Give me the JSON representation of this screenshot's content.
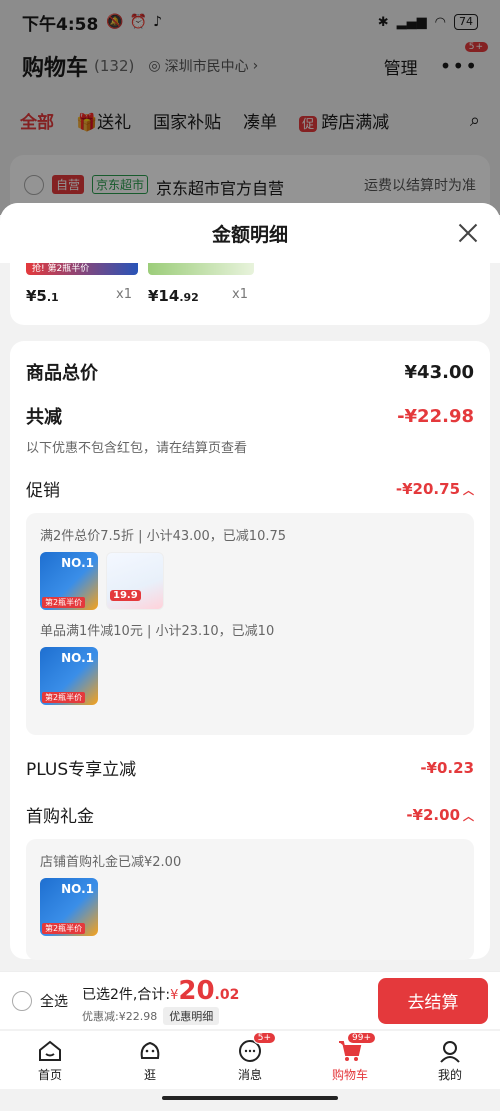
{
  "status": {
    "time": "下午4:58",
    "battery": "74"
  },
  "cart": {
    "title": "购物车",
    "count": "(132)",
    "location": "深圳市民中心",
    "manage": "管理",
    "more_badge": "5+"
  },
  "tabs": [
    "全部",
    "送礼",
    "国家补贴",
    "凑单",
    "跨店满减"
  ],
  "promo_tab_tag": "促",
  "store": {
    "self_tag": "自营",
    "jd_tag": "京东超市",
    "name": "京东超市官方自营",
    "shipping": "运费以结算时为准"
  },
  "sheet": {
    "title": "金额明细"
  },
  "items": [
    {
      "thumb_label": "抢! 第2瓶半价",
      "price_int": "¥5",
      "price_dec": ".1",
      "qty": "x1"
    },
    {
      "price_int": "¥14",
      "price_dec": ".92",
      "qty": "x1"
    }
  ],
  "detail": {
    "total_label": "商品总价",
    "total_value": "¥43.00",
    "reduce_label": "共减",
    "reduce_value": "-¥22.98",
    "hint": "以下优惠不包含红包，请在结算页查看",
    "promo_label": "促销",
    "promo_value": "-¥20.75",
    "promo_line_1": "满2件总价7.5折 | 小计43.00，已减10.75",
    "promo_line_2": "单品满1件减10元 | 小计23.10，已减10",
    "product_no1": "NO.1",
    "product_tag": "第2瓶半价",
    "product_price": "19.9",
    "plus_label": "PLUS专享立减",
    "plus_value": "-¥0.23",
    "gift_label": "首购礼金",
    "gift_value": "-¥2.00",
    "gift_line": "店铺首购礼金已减¥2.00"
  },
  "checkout": {
    "select_all": "全选",
    "selected_text": "已选2件,合计:",
    "yen": "¥",
    "sum_int": "20",
    "sum_dec": ".02",
    "discount_text": "优惠减:¥22.98",
    "discount_btn": "优惠明细",
    "button": "去结算"
  },
  "tabbar": [
    {
      "label": "首页",
      "icon": "home-icon"
    },
    {
      "label": "逛",
      "icon": "stroll-icon"
    },
    {
      "label": "消息",
      "icon": "message-icon",
      "badge": "5+"
    },
    {
      "label": "购物车",
      "icon": "cart-icon",
      "badge": "99+"
    },
    {
      "label": "我的",
      "icon": "profile-icon"
    }
  ],
  "colors": {
    "accent": "#e4393c"
  }
}
